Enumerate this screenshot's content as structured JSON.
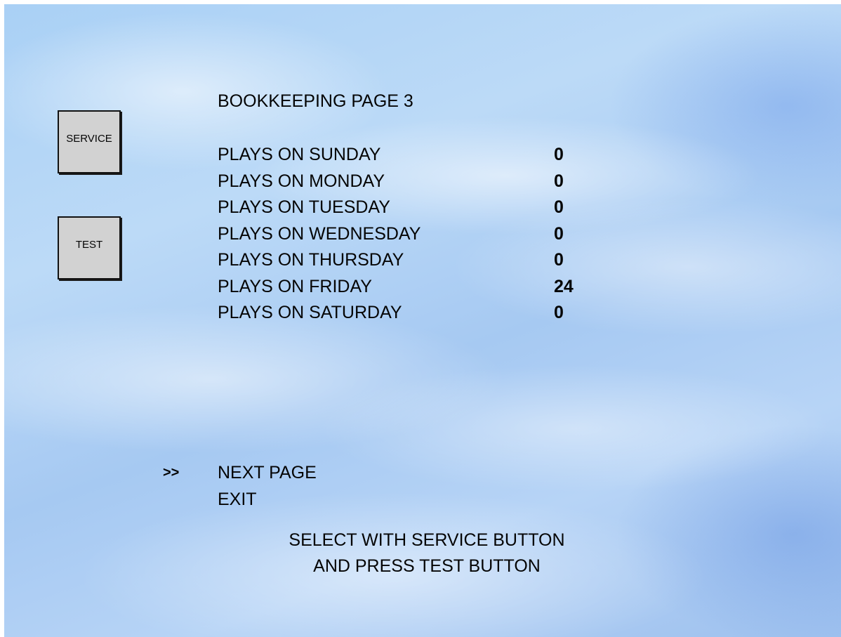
{
  "buttons": {
    "service_label": "SERVICE",
    "test_label": "TEST"
  },
  "page": {
    "title": "BOOKKEEPING PAGE 3"
  },
  "stats": [
    {
      "label": "PLAYS ON SUNDAY",
      "value": "0"
    },
    {
      "label": "PLAYS ON MONDAY",
      "value": "0"
    },
    {
      "label": "PLAYS ON TUESDAY",
      "value": "0"
    },
    {
      "label": "PLAYS ON WEDNESDAY",
      "value": "0"
    },
    {
      "label": "PLAYS ON THURSDAY",
      "value": "0"
    },
    {
      "label": "PLAYS ON FRIDAY",
      "value": "24"
    },
    {
      "label": "PLAYS ON SATURDAY",
      "value": "0"
    }
  ],
  "menu": {
    "cursor": ">>",
    "items": [
      {
        "label": "NEXT PAGE"
      },
      {
        "label": "EXIT"
      }
    ]
  },
  "instructions": {
    "line1": "SELECT WITH SERVICE BUTTON",
    "line2": "AND PRESS TEST BUTTON"
  }
}
